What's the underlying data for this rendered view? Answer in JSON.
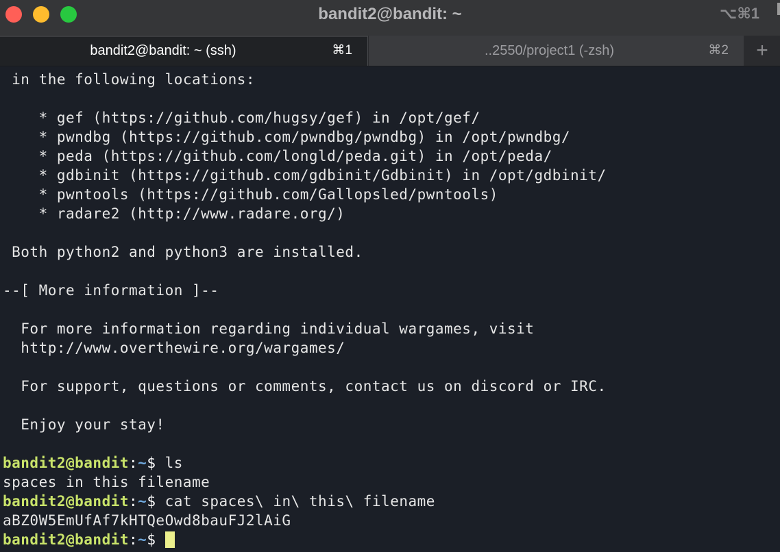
{
  "window": {
    "title": "bandit2@bandit: ~",
    "shortcut": "⌥⌘1"
  },
  "tabs": [
    {
      "label": "bandit2@bandit: ~ (ssh)",
      "shortcut": "⌘1",
      "active": true
    },
    {
      "label": "..2550/project1 (-zsh)",
      "shortcut": "⌘2",
      "active": false
    }
  ],
  "new_tab_label": "+",
  "terminal": {
    "lines": [
      " in the following locations:",
      "",
      "    * gef (https://github.com/hugsy/gef) in /opt/gef/",
      "    * pwndbg (https://github.com/pwndbg/pwndbg) in /opt/pwndbg/",
      "    * peda (https://github.com/longld/peda.git) in /opt/peda/",
      "    * gdbinit (https://github.com/gdbinit/Gdbinit) in /opt/gdbinit/",
      "    * pwntools (https://github.com/Gallopsled/pwntools)",
      "    * radare2 (http://www.radare.org/)",
      "",
      " Both python2 and python3 are installed.",
      "",
      "--[ More information ]--",
      "",
      "  For more information regarding individual wargames, visit",
      "  http://www.overthewire.org/wargames/",
      "",
      "  For support, questions or comments, contact us on discord or IRC.",
      "",
      "  Enjoy your stay!",
      ""
    ],
    "session": [
      {
        "user": "bandit2@bandit",
        "sep": ":",
        "dir": "~",
        "suffix": "$ ",
        "command": "ls",
        "output": "spaces in this filename"
      },
      {
        "user": "bandit2@bandit",
        "sep": ":",
        "dir": "~",
        "suffix": "$ ",
        "command": "cat spaces\\ in\\ this\\ filename",
        "output": "aBZ0W5EmUfAf7kHTQeOwd8bauFJ2lAiG"
      },
      {
        "user": "bandit2@bandit",
        "sep": ":",
        "dir": "~",
        "suffix": "$ ",
        "command": "",
        "output": null
      }
    ]
  },
  "colors": {
    "prompt_user": "#c9e36a",
    "prompt_dir": "#6fa8dc",
    "cursor": "#ecf08d",
    "background": "#1b1f27"
  }
}
